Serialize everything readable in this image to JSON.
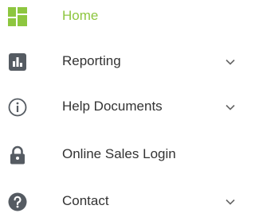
{
  "colors": {
    "active": "#8dc63f",
    "icon": "#555b62",
    "text": "#333333",
    "chevron": "#666666"
  },
  "nav": {
    "items": [
      {
        "label": "Home",
        "icon": "dashboard-grid-icon",
        "active": true,
        "expandable": false
      },
      {
        "label": "Reporting",
        "icon": "bar-chart-icon",
        "active": false,
        "expandable": true
      },
      {
        "label": "Help Documents",
        "icon": "info-circle-icon",
        "active": false,
        "expandable": true
      },
      {
        "label": "Online Sales Login",
        "icon": "lock-icon",
        "active": false,
        "expandable": false
      },
      {
        "label": "Contact",
        "icon": "question-circle-icon",
        "active": false,
        "expandable": true
      }
    ]
  }
}
